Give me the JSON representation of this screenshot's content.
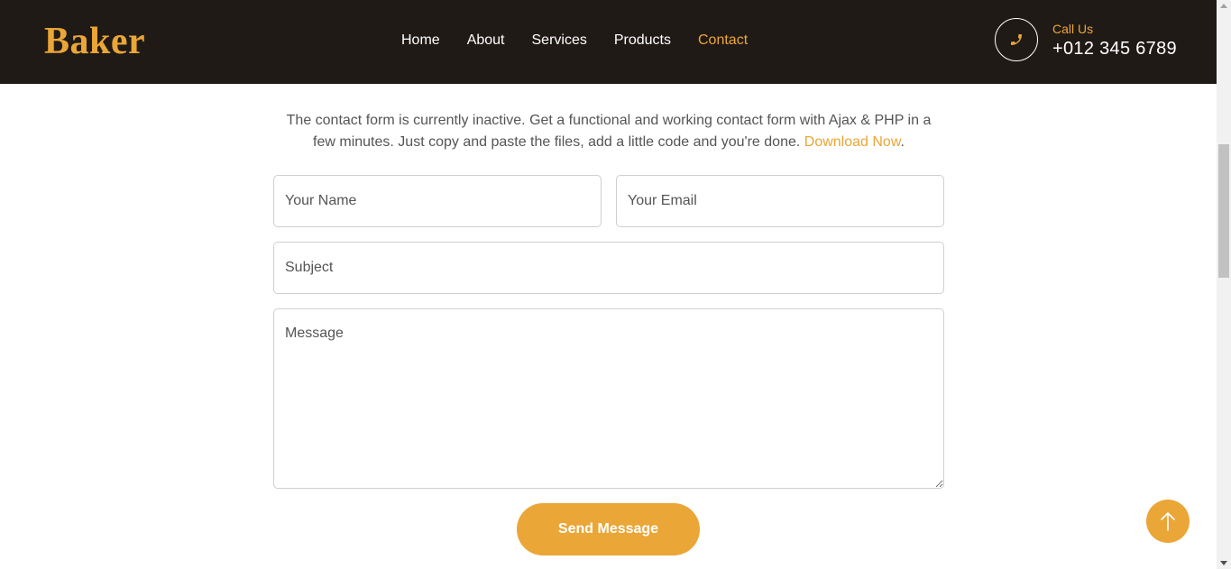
{
  "header": {
    "brand": "Baker",
    "nav": [
      {
        "label": "Home",
        "active": false
      },
      {
        "label": "About",
        "active": false
      },
      {
        "label": "Services",
        "active": false
      },
      {
        "label": "Products",
        "active": false
      },
      {
        "label": "Contact",
        "active": true
      }
    ],
    "call": {
      "label": "Call Us",
      "number": "+012 345 6789",
      "icon": "phone-icon"
    }
  },
  "contact": {
    "intro_text": "The contact form is currently inactive. Get a functional and working contact form with Ajax & PHP in a few minutes. Just copy and paste the files, add a little code and you're done.",
    "intro_link": "Download Now",
    "intro_suffix": ".",
    "form": {
      "name_placeholder": "Your Name",
      "email_placeholder": "Your Email",
      "subject_placeholder": "Subject",
      "message_placeholder": "Message",
      "submit_label": "Send Message"
    }
  },
  "back_to_top": {
    "icon": "arrow-up-icon"
  },
  "colors": {
    "accent": "#eaa636",
    "header_bg": "#201a17",
    "text": "#555555"
  }
}
